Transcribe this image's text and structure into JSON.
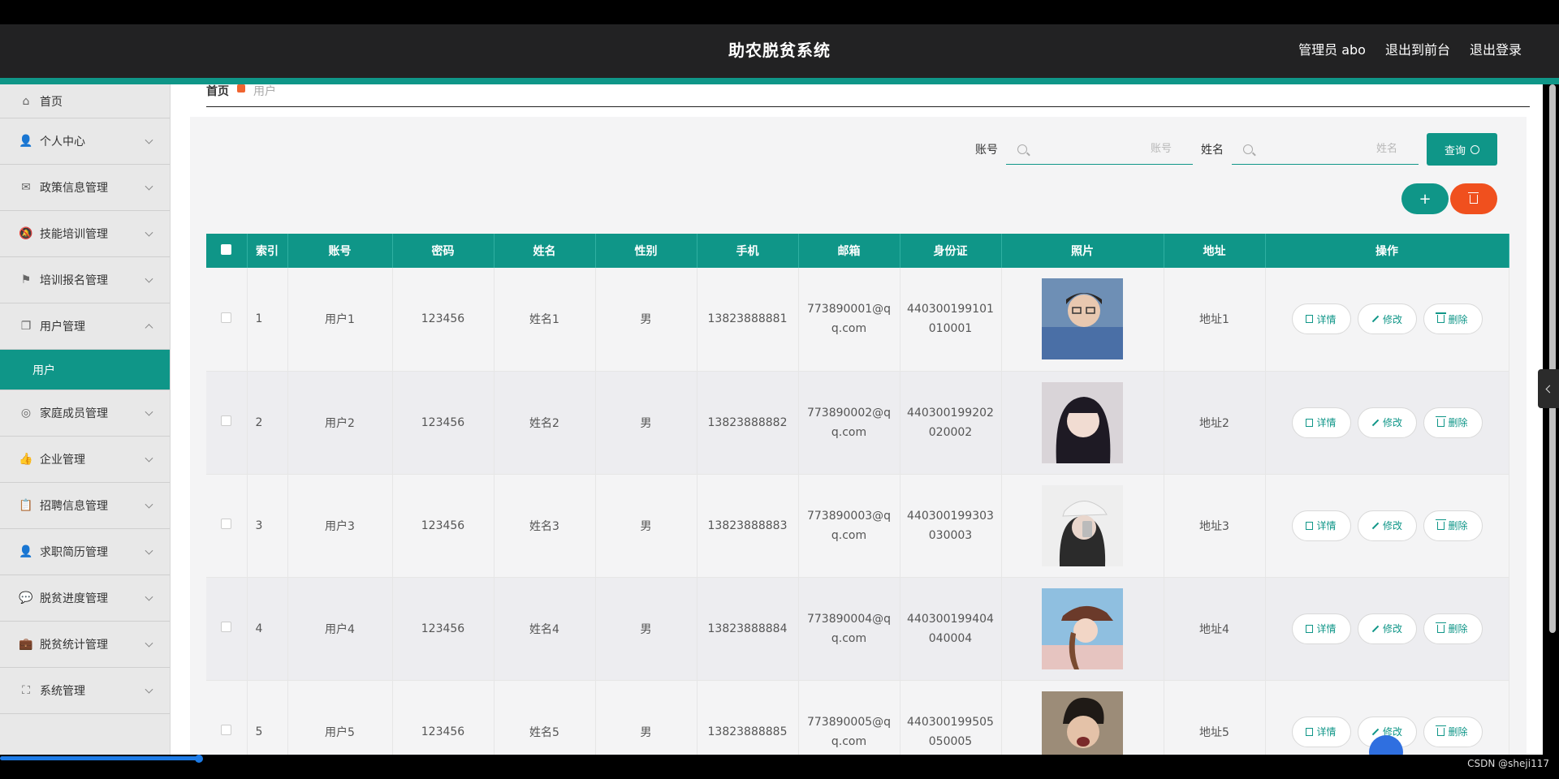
{
  "header": {
    "title": "助农脱贫系统",
    "admin_label": "管理员 abo",
    "to_front": "退出到前台",
    "logout": "退出登录"
  },
  "sidebar": {
    "items": [
      {
        "label": "首页",
        "icon": "home-icon"
      },
      {
        "label": "个人中心",
        "icon": "user-icon"
      },
      {
        "label": "政策信息管理",
        "icon": "mail-icon"
      },
      {
        "label": "技能培训管理",
        "icon": "bell-off-icon"
      },
      {
        "label": "培训报名管理",
        "icon": "flag-icon"
      },
      {
        "label": "用户管理",
        "icon": "copy-icon",
        "expanded": true
      },
      {
        "label": "家庭成员管理",
        "icon": "circle-icon"
      },
      {
        "label": "企业管理",
        "icon": "thumb-icon"
      },
      {
        "label": "招聘信息管理",
        "icon": "clipboard-icon"
      },
      {
        "label": "求职简历管理",
        "icon": "user-icon"
      },
      {
        "label": "脱贫进度管理",
        "icon": "chat-icon"
      },
      {
        "label": "脱贫统计管理",
        "icon": "briefcase-icon"
      },
      {
        "label": "系统管理",
        "icon": "fullscreen-icon"
      }
    ],
    "submenu_label": "用户"
  },
  "breadcrumb": {
    "home": "首页",
    "current": "用户"
  },
  "search": {
    "account_label": "账号",
    "account_placeholder": "账号",
    "name_label": "姓名",
    "name_placeholder": "姓名",
    "query_label": "查询"
  },
  "table": {
    "headers": [
      "索引",
      "账号",
      "密码",
      "姓名",
      "性别",
      "手机",
      "邮箱",
      "身份证",
      "照片",
      "地址",
      "操作"
    ],
    "rows": [
      {
        "index": "1",
        "account": "用户1",
        "password": "123456",
        "name": "姓名1",
        "gender": "男",
        "phone": "13823888881",
        "email_a": "773890001@q",
        "email_b": "q.com",
        "id_a": "440300199101",
        "id_b": "010001",
        "address": "地址1"
      },
      {
        "index": "2",
        "account": "用户2",
        "password": "123456",
        "name": "姓名2",
        "gender": "男",
        "phone": "13823888882",
        "email_a": "773890002@q",
        "email_b": "q.com",
        "id_a": "440300199202",
        "id_b": "020002",
        "address": "地址2"
      },
      {
        "index": "3",
        "account": "用户3",
        "password": "123456",
        "name": "姓名3",
        "gender": "男",
        "phone": "13823888883",
        "email_a": "773890003@q",
        "email_b": "q.com",
        "id_a": "440300199303",
        "id_b": "030003",
        "address": "地址3"
      },
      {
        "index": "4",
        "account": "用户4",
        "password": "123456",
        "name": "姓名4",
        "gender": "男",
        "phone": "13823888884",
        "email_a": "773890004@q",
        "email_b": "q.com",
        "id_a": "440300199404",
        "id_b": "040004",
        "address": "地址4"
      },
      {
        "index": "5",
        "account": "用户5",
        "password": "123456",
        "name": "姓名5",
        "gender": "男",
        "phone": "13823888885",
        "email_a": "773890005@q",
        "email_b": "q.com",
        "id_a": "440300199505",
        "id_b": "050005",
        "address": "地址5"
      }
    ],
    "op_detail": "详情",
    "op_edit": "修改",
    "op_delete": "删除"
  },
  "footer": {
    "credit": "CSDN @sheji117"
  },
  "colors": {
    "accent": "#0f9688",
    "danger": "#f0501e",
    "header_bg": "#222223"
  }
}
